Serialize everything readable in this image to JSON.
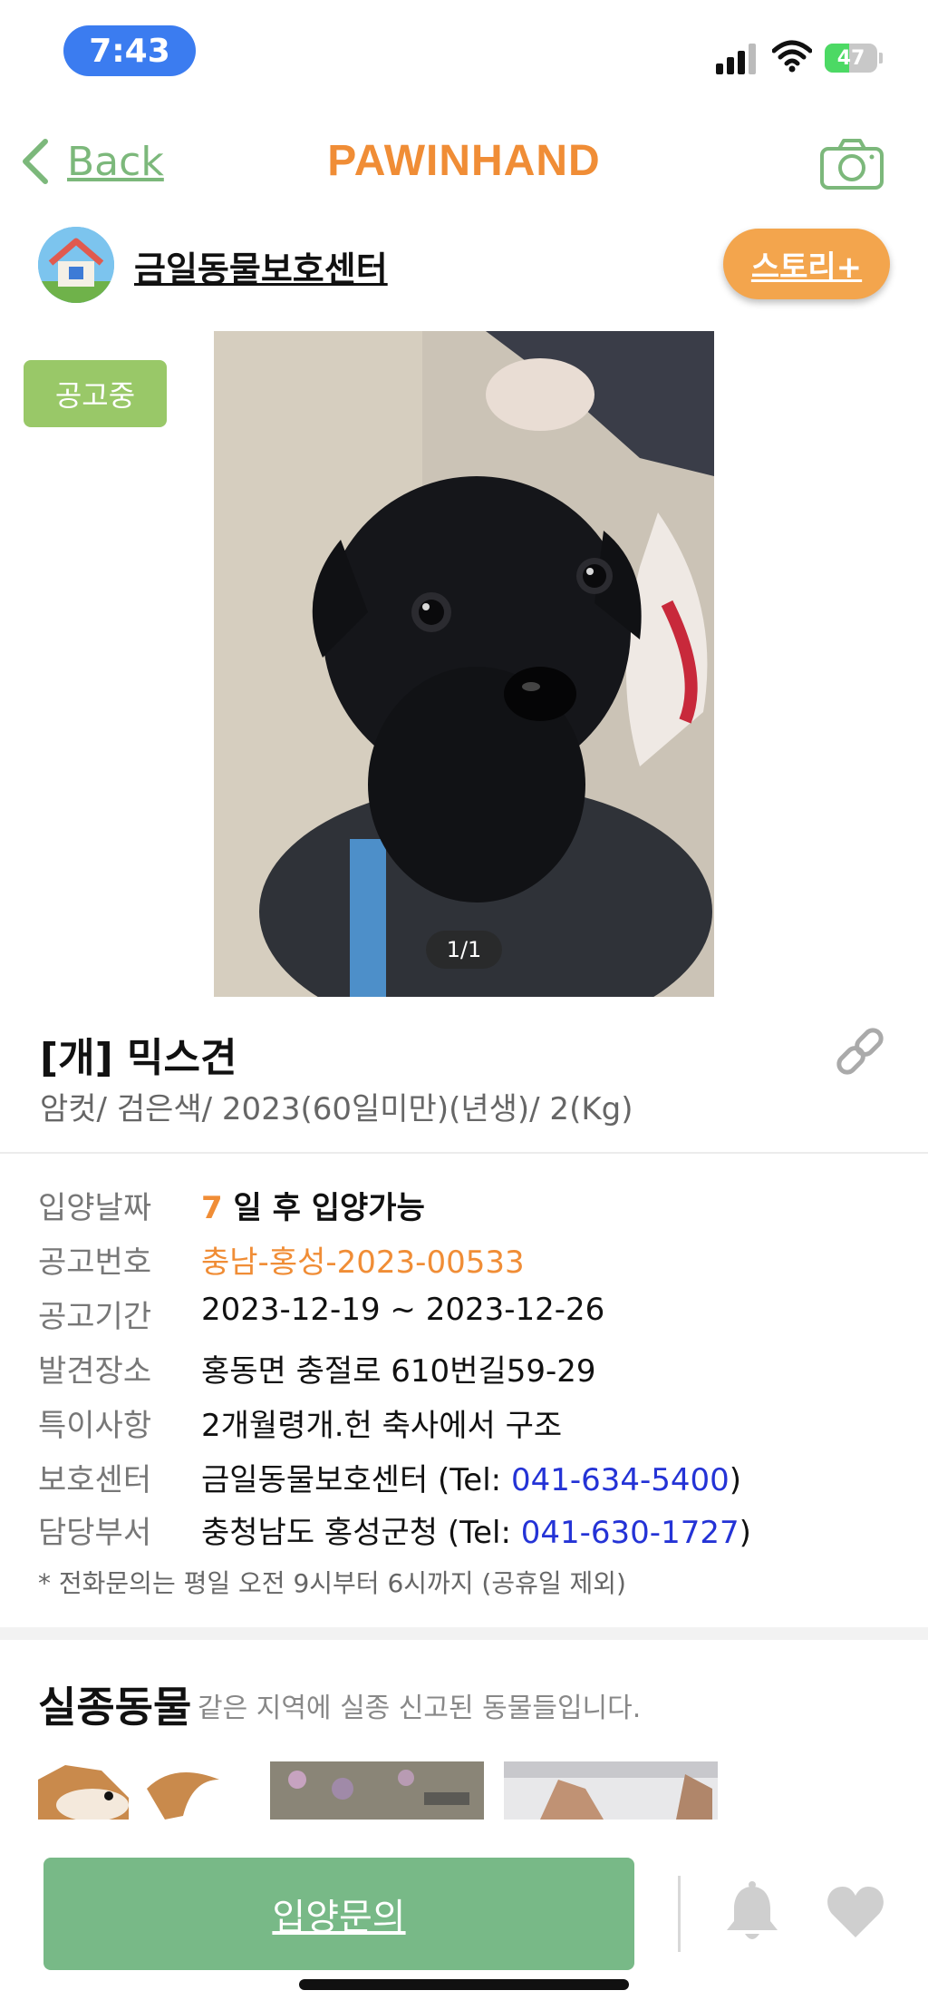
{
  "status_bar": {
    "time": "7:43",
    "battery": "47",
    "battery_level": 0.47
  },
  "header": {
    "back_label": "Back",
    "brand": "PAWINHAND"
  },
  "shelter": {
    "name": "금일동물보호센터",
    "story_button": "스토리+"
  },
  "badge": {
    "label": "공고중"
  },
  "photo": {
    "counter": "1/1"
  },
  "pet": {
    "title": "[개] 믹스견",
    "subtitle": "암컷/ 검은색/ 2023(60일미만)(년생)/ 2(Kg)"
  },
  "details": {
    "adoption": {
      "label": "입양날짜",
      "days": "7",
      "text": "일 후 입양가능"
    },
    "notice_no": {
      "label": "공고번호",
      "value": "충남-홍성-2023-00533"
    },
    "period": {
      "label": "공고기간",
      "value": "2023-12-19 ~ 2023-12-26"
    },
    "found": {
      "label": "발견장소",
      "value": "홍동면 충절로 610번길59-29"
    },
    "special": {
      "label": "특이사항",
      "value": "2개월령개.헌 축사에서 구조"
    },
    "center": {
      "label": "보호센터",
      "value": "금일동물보호센터 (Tel: ",
      "tel": "041-634-5400",
      "close": ")"
    },
    "dept": {
      "label": "담당부서",
      "value": "충청남도 홍성군청 (Tel: ",
      "tel": "041-630-1727",
      "close": ")"
    },
    "note": "* 전화문의는 평일 오전 9시부터 6시까지 (공휴일 제외)"
  },
  "missing": {
    "title": "실종동물",
    "description": "같은 지역에 실종 신고된 동물들입니다."
  },
  "bottom": {
    "inquiry_button": "입양문의"
  },
  "colors": {
    "accent_green": "#78b987",
    "brand_orange": "#f08d36",
    "tel_blue": "#2433d6"
  }
}
